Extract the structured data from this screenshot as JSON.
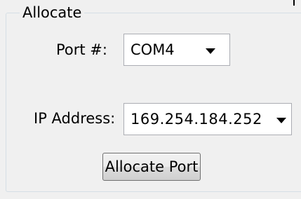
{
  "allocate_group": {
    "title": "Allocate",
    "port": {
      "label": "Port #:",
      "selected": "COM4"
    },
    "ip": {
      "label": "IP Address:",
      "selected": "169.254.184.252"
    },
    "allocate_button_label": "Allocate Port"
  },
  "icons": {
    "dropdown_arrow": "chevron-down-icon"
  },
  "colors": {
    "panel_background": "#f0f0f0",
    "groupbox_border": "#d5dfe5",
    "input_border": "#abadb3",
    "button_border": "#707070"
  }
}
